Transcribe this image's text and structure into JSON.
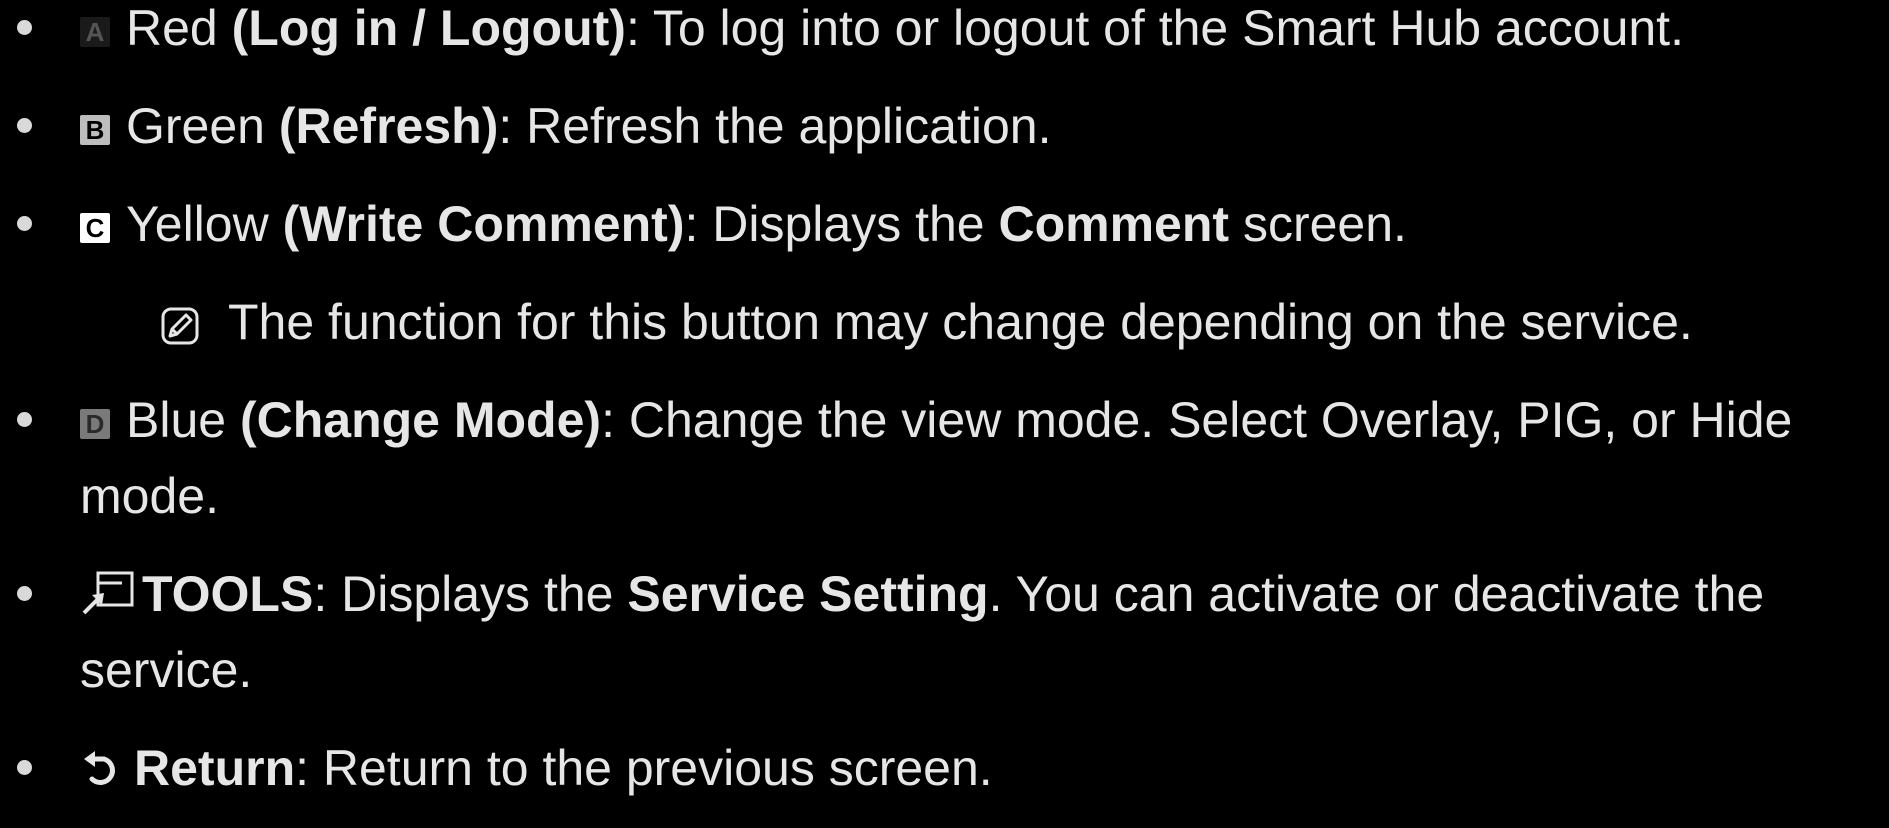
{
  "items": [
    {
      "key_letter": "A",
      "color": "Red",
      "open": " (",
      "function": "Log in / Logout",
      "close": ")",
      "desc": ": To log into or logout of the Smart Hub account."
    },
    {
      "key_letter": "B",
      "color": "Green",
      "open": " (",
      "function": "Refresh",
      "close": ")",
      "desc": ": Refresh the application."
    },
    {
      "key_letter": "C",
      "color": "Yellow",
      "open": " (",
      "function": "Write Comment",
      "close": ")",
      "desc_before": ": Displays the ",
      "desc_bold": "Comment",
      "desc_after": " screen."
    },
    {
      "key_letter": "D",
      "color": "Blue",
      "open": " (",
      "function": "Change Mode",
      "close": ")",
      "desc": ": Change the view mode. Select Overlay, PIG, or Hide mode."
    },
    {
      "label": "TOOLS",
      "desc_before": ": Displays the ",
      "desc_bold": "Service Setting",
      "desc_after": ". You can activate or deactivate the service."
    },
    {
      "label": "Return",
      "desc": ": Return to the previous screen."
    }
  ],
  "note": {
    "text": "The function for this button may change depending on the service."
  },
  "icons": {
    "note": "note-icon",
    "tools": "tools-icon",
    "return": "return-icon"
  },
  "colors": {
    "background": "#000000",
    "text": "#e6e6e6"
  }
}
